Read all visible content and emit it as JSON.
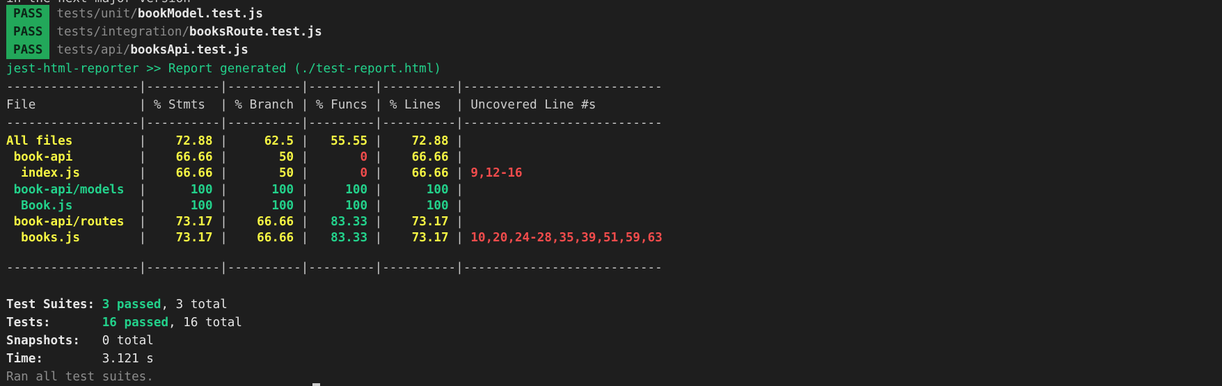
{
  "top_cut_text": "in the next major version",
  "pass_rows": [
    {
      "badge": "PASS",
      "dir": "tests/unit/",
      "file": "bookModel.test.js"
    },
    {
      "badge": "PASS",
      "dir": "tests/integration/",
      "file": "booksRoute.test.js"
    },
    {
      "badge": "PASS",
      "dir": "tests/api/",
      "file": "booksApi.test.js"
    }
  ],
  "reporter_line": "jest-html-reporter >> Report generated (./test-report.html)",
  "coverage": {
    "separator": "------------------|----------|----------|---------|----------|---------------------------",
    "headers": {
      "file": "File",
      "stmts": "% Stmts",
      "branch": "% Branch",
      "funcs": "% Funcs",
      "lines": "% Lines",
      "uncovered": "Uncovered Line #s"
    },
    "rows": [
      {
        "file": "All files",
        "stmts": "72.88",
        "branch": "62.5",
        "funcs": "55.55",
        "lines": "72.88",
        "uncovered": ""
      },
      {
        "file": " book-api",
        "stmts": "66.66",
        "branch": "50",
        "funcs": "0",
        "lines": "66.66",
        "uncovered": ""
      },
      {
        "file": "  index.js",
        "stmts": "66.66",
        "branch": "50",
        "funcs": "0",
        "lines": "66.66",
        "uncovered": "9,12-16"
      },
      {
        "file": " book-api/models",
        "stmts": "100",
        "branch": "100",
        "funcs": "100",
        "lines": "100",
        "uncovered": ""
      },
      {
        "file": "  Book.js",
        "stmts": "100",
        "branch": "100",
        "funcs": "100",
        "lines": "100",
        "uncovered": ""
      },
      {
        "file": " book-api/routes",
        "stmts": "73.17",
        "branch": "66.66",
        "funcs": "83.33",
        "lines": "73.17",
        "uncovered": ""
      },
      {
        "file": "  books.js",
        "stmts": "73.17",
        "branch": "66.66",
        "funcs": "83.33",
        "lines": "73.17",
        "uncovered": "10,20,24-28,35,39,51,59,63"
      }
    ]
  },
  "summary": {
    "suites_label": "Test Suites:",
    "suites_passed": "3 passed",
    "suites_total": ", 3 total",
    "tests_label": "Tests:",
    "tests_passed": "16 passed",
    "tests_total": ", 16 total",
    "snapshots_label": "Snapshots:",
    "snapshots_value": "0 total",
    "time_label": "Time:",
    "time_value": "3.121 s",
    "ran_all": "Ran all test suites."
  },
  "colors": {
    "background": "#1e1e1e",
    "pass_badge": "#22a85a",
    "green": "#23d18b",
    "yellow": "#f5f543",
    "red": "#f14c4c"
  }
}
